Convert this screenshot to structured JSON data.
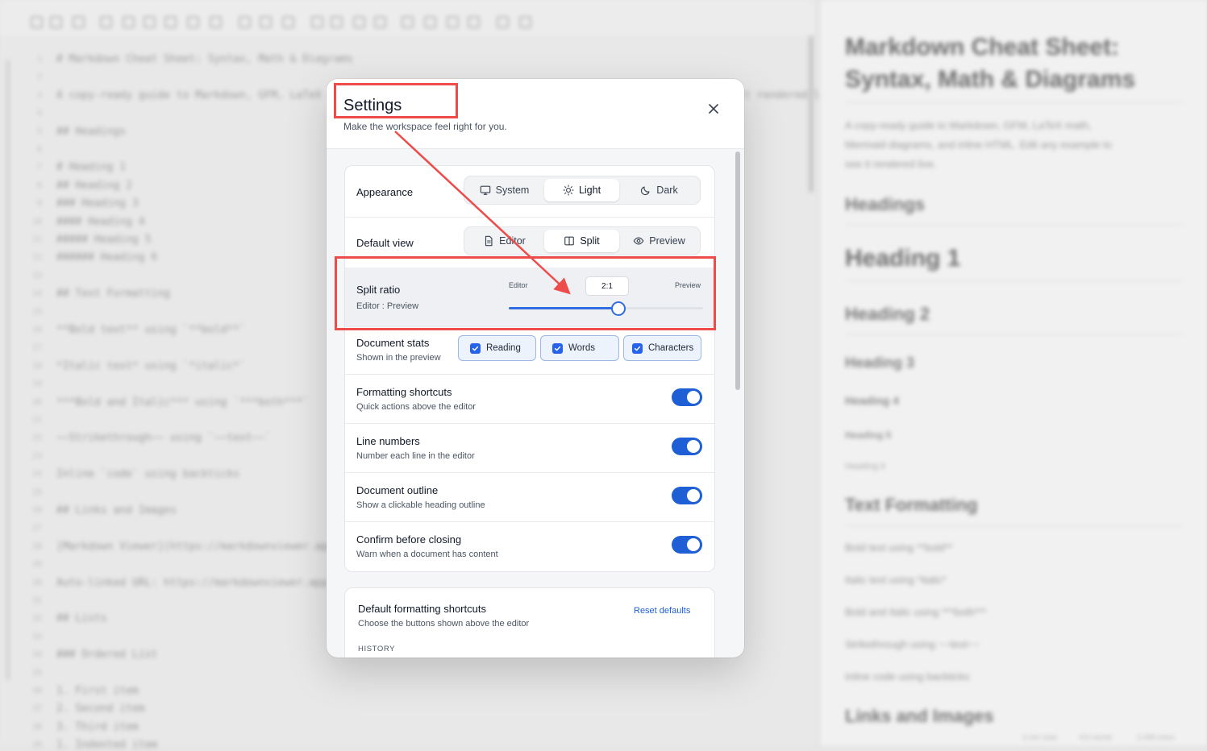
{
  "modal": {
    "title": "Settings",
    "subtitle": "Make the workspace feel right for you.",
    "close_icon": "close-icon"
  },
  "settings": {
    "appearance": {
      "label": "Appearance",
      "options": [
        {
          "label": "System",
          "icon": "monitor-icon"
        },
        {
          "label": "Light",
          "icon": "sun-icon"
        },
        {
          "label": "Dark",
          "icon": "moon-icon"
        }
      ],
      "selected": "Light"
    },
    "default_view": {
      "label": "Default view",
      "options": [
        {
          "label": "Editor",
          "icon": "file-text-icon"
        },
        {
          "label": "Split",
          "icon": "columns-icon"
        },
        {
          "label": "Preview",
          "icon": "eye-icon"
        }
      ],
      "selected": "Split"
    },
    "split_ratio": {
      "label": "Split ratio",
      "description": "Editor : Preview",
      "left_label": "Editor",
      "right_label": "Preview",
      "value": "2:1",
      "slider_fraction": 0.56
    },
    "document_stats": {
      "label": "Document stats",
      "description": "Shown in the preview",
      "options": [
        {
          "label": "Reading",
          "checked": true
        },
        {
          "label": "Words",
          "checked": true
        },
        {
          "label": "Characters",
          "checked": true
        }
      ]
    },
    "toggles": [
      {
        "label": "Formatting shortcuts",
        "description": "Quick actions above the editor",
        "on": true
      },
      {
        "label": "Line numbers",
        "description": "Number each line in the editor",
        "on": true
      },
      {
        "label": "Document outline",
        "description": "Show a clickable heading outline",
        "on": true
      },
      {
        "label": "Confirm before closing",
        "description": "Warn when a document has content",
        "on": true
      }
    ],
    "shortcuts": {
      "label": "Default formatting shortcuts",
      "description": "Choose the buttons shown above the editor",
      "reset_label": "Reset defaults",
      "section_label": "HISTORY"
    }
  },
  "background": {
    "editor_lines": [
      {
        "n": "1",
        "text": "# Markdown Cheat Sheet: Syntax, Math & Diagrams"
      },
      {
        "n": "2",
        "text": ""
      },
      {
        "n": "3",
        "text": "A copy-ready guide to Markdown, GFM, LaTeX math, Mermaid diagrams, and inline HTML. Edit any example to see it rendered live."
      },
      {
        "n": "4",
        "text": ""
      },
      {
        "n": "5",
        "text": "## Headings"
      },
      {
        "n": "6",
        "text": ""
      },
      {
        "n": "7",
        "text": "# Heading 1"
      },
      {
        "n": "8",
        "text": "## Heading 2"
      },
      {
        "n": "9",
        "text": "### Heading 3"
      },
      {
        "n": "10",
        "text": "#### Heading 4"
      },
      {
        "n": "11",
        "text": "##### Heading 5"
      },
      {
        "n": "12",
        "text": "###### Heading 6"
      },
      {
        "n": "13",
        "text": ""
      },
      {
        "n": "14",
        "text": "## Text Formatting"
      },
      {
        "n": "15",
        "text": ""
      },
      {
        "n": "16",
        "text": "**Bold text** using `**bold**`"
      },
      {
        "n": "17",
        "text": ""
      },
      {
        "n": "18",
        "text": "*Italic text* using `*italic*`"
      },
      {
        "n": "19",
        "text": ""
      },
      {
        "n": "20",
        "text": "***Bold and Italic*** using `***both***`"
      },
      {
        "n": "21",
        "text": ""
      },
      {
        "n": "22",
        "text": "~~Strikethrough~~ using `~~text~~`"
      },
      {
        "n": "23",
        "text": ""
      },
      {
        "n": "24",
        "text": "Inline `code` using backticks"
      },
      {
        "n": "25",
        "text": ""
      },
      {
        "n": "26",
        "text": "## Links and Images"
      },
      {
        "n": "27",
        "text": ""
      },
      {
        "n": "28",
        "text": "[Markdown Viewer](https://markdownviewer.app)"
      },
      {
        "n": "29",
        "text": ""
      },
      {
        "n": "30",
        "text": "Auto-linked URL: https://markdownviewer.app"
      },
      {
        "n": "31",
        "text": ""
      },
      {
        "n": "32",
        "text": "## Lists"
      },
      {
        "n": "33",
        "text": ""
      },
      {
        "n": "34",
        "text": "### Ordered List"
      },
      {
        "n": "35",
        "text": ""
      },
      {
        "n": "36",
        "text": "1. First item"
      },
      {
        "n": "37",
        "text": "2. Second item"
      },
      {
        "n": "38",
        "text": "3. Third item"
      },
      {
        "n": "39",
        "text": "   1. Indented item"
      }
    ],
    "preview": {
      "title_line1": "Markdown Cheat Sheet:",
      "title_line2": "Syntax, Math & Diagrams",
      "intro_line1": "A copy-ready guide to Markdown, GFM, LaTeX math,",
      "intro_line2": "Mermaid diagrams, and inline HTML. Edit any example to",
      "intro_line3": "see it rendered live.",
      "headings": "Headings",
      "h1": "Heading 1",
      "h2": "Heading 2",
      "h3": "Heading 3",
      "h4": "Heading 4",
      "h5": "Heading 5",
      "h6": "Heading 6",
      "text_formatting": "Text Formatting",
      "bold": "Bold text using **bold**",
      "italic": "Italic text using *italic*",
      "bold_italic": "Bold and Italic using ***both***",
      "strike": "Strikethrough using ~~text~~",
      "inline": "Inline code using backticks",
      "links_images": "Links and Images",
      "status": [
        "3 min read",
        "410 words",
        "2,498 chars"
      ]
    }
  },
  "annotation": {
    "color": "#ee4b4b"
  }
}
